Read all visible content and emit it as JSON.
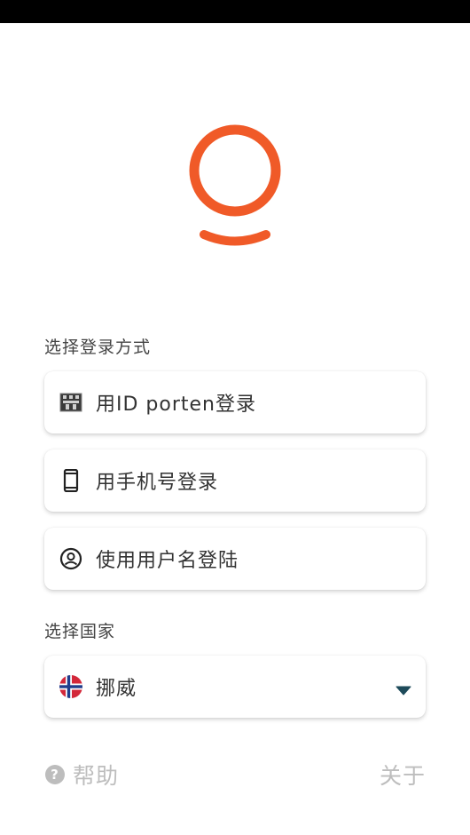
{
  "login": {
    "section_title": "选择登录方式",
    "options": [
      {
        "label": "用ID porten登录",
        "icon": "castle-icon"
      },
      {
        "label": "用手机号登录",
        "icon": "smartphone-icon"
      },
      {
        "label": "使用用户名登陆",
        "icon": "account-circle-icon"
      }
    ]
  },
  "country": {
    "section_title": "选择国家",
    "selected": "挪威",
    "flag": "norway-flag-icon"
  },
  "footer": {
    "help_label": "帮助",
    "about_label": "关于"
  },
  "colors": {
    "brand_orange": "#f05a28",
    "dropdown_arrow": "#1d4a5a",
    "muted_text": "#bdbdbd"
  }
}
